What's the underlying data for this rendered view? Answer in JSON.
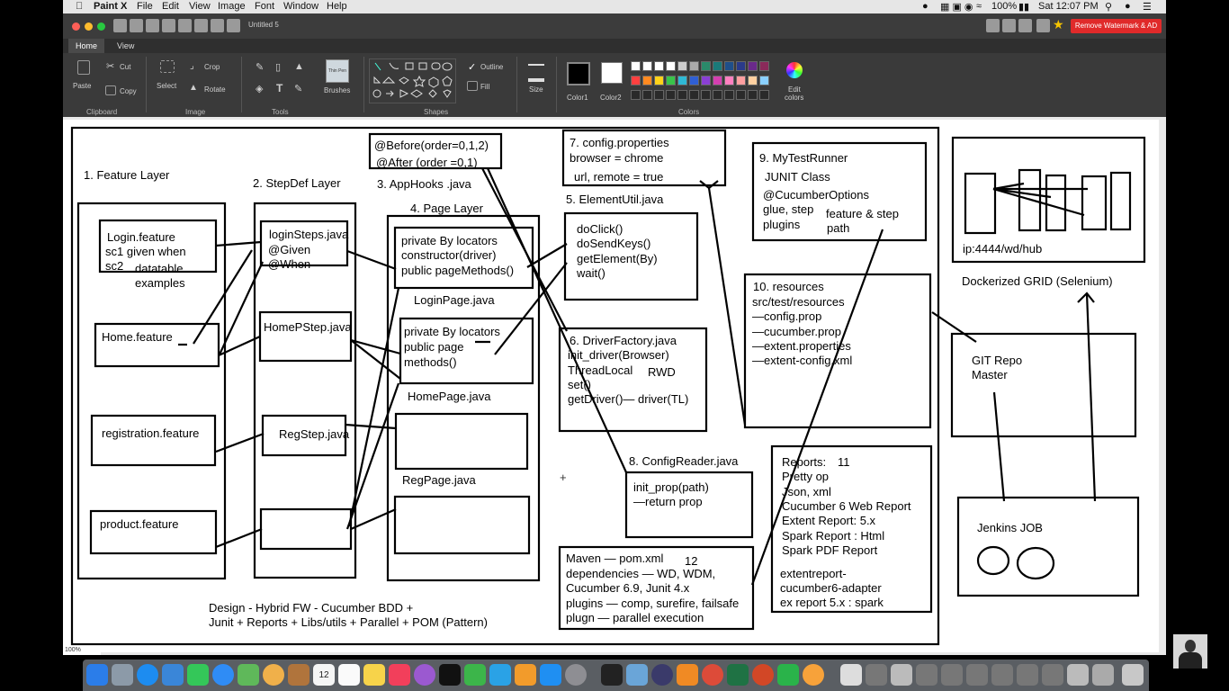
{
  "menubar": {
    "app": "Paint X",
    "items": [
      "File",
      "Edit",
      "View",
      "Image",
      "Font",
      "Window",
      "Help"
    ],
    "battery": "100%",
    "clock": "Sat 12:07 PM"
  },
  "window": {
    "doc_title": "Untitled 5",
    "watermark_button": "Remove Watermark & AD"
  },
  "tabs": [
    {
      "label": "Home",
      "active": true
    },
    {
      "label": "View",
      "active": false
    }
  ],
  "ribbon": {
    "paste": "Paste",
    "cut": "Cut",
    "copy": "Copy",
    "clipboard": "Clipboard",
    "select": "Select",
    "crop": "Crop",
    "rotate": "Rotate",
    "image": "Image",
    "tools": "Tools",
    "brush_thumb": "Thin Pen",
    "brushes": "Brushes",
    "shapes": "Shapes",
    "outline": "Outline",
    "fill": "Fill",
    "size": "Size",
    "color1": "Color1",
    "color2": "Color2",
    "colors": "Colors",
    "edit_colors_1": "Edit",
    "edit_colors_2": "colors",
    "palette_row1": [
      "#ffffff",
      "#ffffff",
      "#ffffff",
      "#ffffff",
      "#cccccc",
      "#aaaaaa",
      "#2a8a6a",
      "#1a7a7a",
      "#1f4f8a",
      "#2a3a8a",
      "#6a2a8a",
      "#8a2a5a"
    ],
    "palette_row2": [
      "#ff4040",
      "#ff8a20",
      "#ffd21a",
      "#39c44a",
      "#2fb9d4",
      "#2f5fd4",
      "#8a3fd4",
      "#d43fb0",
      "#ff80c0",
      "#ff9fa0",
      "#ffd0a0",
      "#8ad0ff"
    ],
    "color1_value": "#000000",
    "color2_value": "#ffffff"
  },
  "canvas": {
    "zoom": "100%",
    "c1": "1. Feature Layer",
    "c2": "2. StepDef Layer",
    "c3": "3. AppHooks .java",
    "c4": "4. Page Layer",
    "h1": "@Before(order=0,1,2)",
    "h2": "@After (order =0,1)",
    "f1": "Login.feature",
    "f2": "sc1 given when",
    "f3": "sc2",
    "f4": "datatable",
    "f5": "examples",
    "f6": "Home.feature",
    "f7": "registration.feature",
    "f8": "product.feature",
    "s1": "loginSteps.java",
    "s2": "@Given",
    "s3": "@When",
    "s4": "HomePStep.java",
    "s5": "RegStep.java",
    "p1": "private By locators",
    "p2": "constructor(driver)",
    "p3": "public pageMethods()",
    "p4": "LoginPage.java",
    "p5": "private By locators",
    "p6": "public page",
    "p7": "methods()",
    "p8": "HomePage.java",
    "p9": "RegPage.java",
    "k1": "7. config.properties",
    "k2": "browser = chrome",
    "k3": "url, remote = true",
    "e0": "5. ElementUtil.java",
    "e1": "doClick()",
    "e2": "doSendKeys()",
    "e3": "getElement(By)",
    "e4": "wait()",
    "d1": "6. DriverFactory.java",
    "d2": "init_driver(Browser)",
    "d3": "ThreadLocal",
    "d4": "RWD",
    "d5": "set()",
    "d6": "getDriver()— driver(TL)",
    "r0": "8. ConfigReader.java",
    "r1": "init_prop(path)",
    "r2": "—return prop",
    "t1": "9. MyTestRunner",
    "t2": "JUNIT Class",
    "t3": "@CucumberOptions",
    "t4": "glue, step",
    "t5": "feature & step",
    "t6": "plugins",
    "t7": "path",
    "res1": "10. resources",
    "res2": "src/test/resources",
    "res3": "—config.prop",
    "res4": "—cucumber.prop",
    "res5": "—extent.properties",
    "res6": "—extent-config.xml",
    "g1": "ip:4444/wd/hub",
    "g2": "Dockerized GRID (Selenium)",
    "git1": "GIT Repo",
    "git2": "Master",
    "j1": "Jenkins JOB",
    "rep1": "Reports:",
    "rep2": "11",
    "rep3": "Pretty op",
    "rep4": "Json, xml",
    "rep5": "Cucumber 6 Web Report",
    "rep6": "Extent Report: 5.x",
    "rep7": "Spark Report : Html",
    "rep8": "Spark PDF Report",
    "rep9": "extentreport-",
    "rep10": "cucumber6-adapter",
    "rep11": "ex report 5.x : spark",
    "m1": "Maven — pom.xml",
    "m2": "12",
    "m3": "dependencies — WD, WDM,",
    "m4": "Cucumber 6.9, Junit 4.x",
    "m5": "plugins — comp, surefire, failsafe",
    "m6": "plugn — parallel execution",
    "b1": "Design - Hybrid FW - Cucumber BDD +",
    "b2": "Junit + Reports + Libs/utils + Parallel + POM (Pattern)",
    "cursor": "+"
  },
  "dock": {
    "calendar_day": "12"
  }
}
